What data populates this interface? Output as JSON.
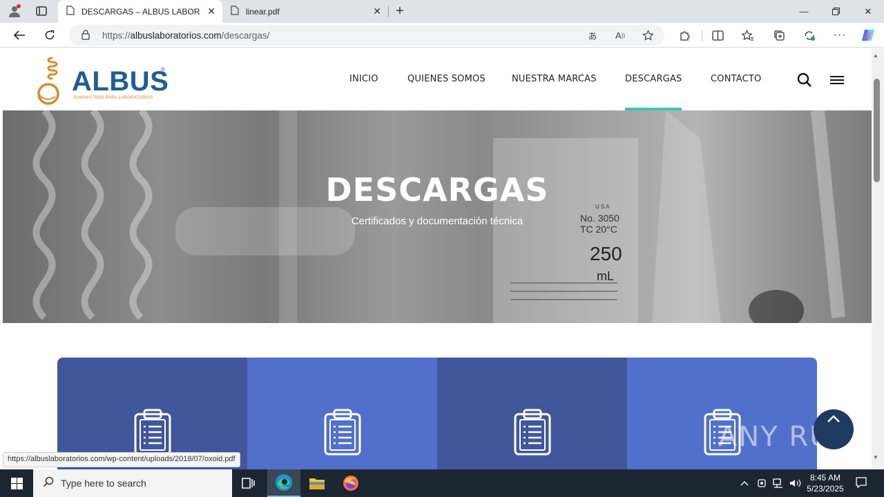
{
  "browser": {
    "tabs": [
      {
        "title": "DESCARGAS – ALBUS LABORATO",
        "active": true
      },
      {
        "title": "linear.pdf",
        "active": false
      }
    ],
    "url_prefix": "https://",
    "url_host": "albuslaboratorios.com",
    "url_path": "/descargas/",
    "status_url": "https://albuslaboratorios.com/wp-content/uploads/2018/07/oxoid.pdf"
  },
  "site": {
    "logo_text": "ALBUS",
    "logo_reg": "®",
    "logo_tagline": "SUMINISTROS PARA LABORATORIOS",
    "menu": [
      {
        "label": "INICIO"
      },
      {
        "label": "QUIENES SOMOS"
      },
      {
        "label": "NUESTRA MARCAS"
      },
      {
        "label": "DESCARGAS",
        "active": true
      },
      {
        "label": "CONTACTO"
      }
    ],
    "hero": {
      "title": "DESCARGAS",
      "subtitle": "Certificados y documentación técnica",
      "bg_labels": [
        "U S A",
        "No. 3050",
        "TC 20°C",
        "250",
        "mL"
      ]
    },
    "cards": [
      {
        "color": "#41579c"
      },
      {
        "color": "#5070cc"
      },
      {
        "color": "#41579c"
      },
      {
        "color": "#5070cc"
      }
    ],
    "watermark": "ANY RUN"
  },
  "taskbar": {
    "search_placeholder": "Type here to search",
    "time": "8:45 AM",
    "date": "5/23/2025"
  },
  "colors": {
    "accent_underline": "#3fc2bd",
    "logo_blue": "#1e5d97",
    "logo_orange": "#d98a2b",
    "back_to_top": "#1e3a60"
  }
}
